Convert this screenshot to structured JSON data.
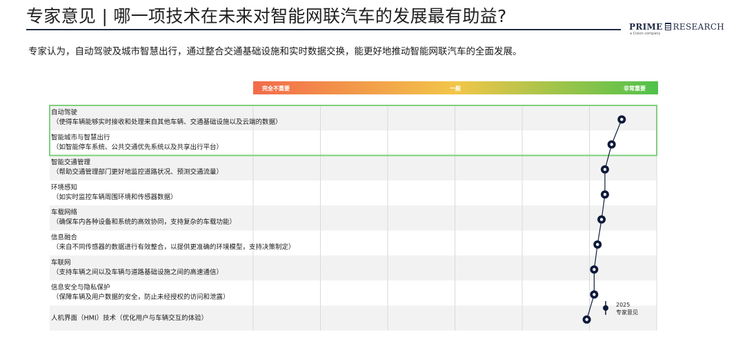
{
  "header": {
    "title": "专家意见 | 哪一项技术在未来对智能网联汽车的发展最有助益?",
    "subtitle": "专家认为，自动驾驶及城市智慧出行，通过整合交通基础设施和实时数据交换，能更好地推动智能网联汽车的全面发展。"
  },
  "logo": {
    "prime": "PRIME",
    "research": "RESEARCH",
    "sub": "a Cision company"
  },
  "colors": {
    "scale_start": "#f26b4a",
    "scale_mid": "#f2c64a",
    "scale_end": "#4fc24a",
    "highlight_border": "#7ed07e",
    "marker": "#0e1a3a",
    "row_shade": "#f2f2f2"
  },
  "chart_data": {
    "type": "scatter",
    "scale_labels": {
      "low": "完全不重要",
      "mid": "一般",
      "high": "非常重要"
    },
    "xlim": [
      0,
      6
    ],
    "grid": true,
    "highlight_rows": [
      0,
      1
    ],
    "legend": {
      "line1": "2025",
      "line2": "专家意见"
    },
    "items": [
      {
        "name": "自动驾驶",
        "desc": "（使得车辆能够实时接收和处理来自其他车辆、交通基础设施以及云端的数据）",
        "value": 5.48
      },
      {
        "name": "智能城市与智慧出行",
        "desc": "（如智能停车系统、公共交通优先系统以及共享出行平台）",
        "value": 5.33
      },
      {
        "name": "智能交通管理",
        "desc": "（帮助交通管理部门更好地监控道路状况、预测交通流量）",
        "value": 5.23
      },
      {
        "name": "环境感知",
        "desc": "（如实时监控车辆周围环境和传感器数据）",
        "value": 5.23
      },
      {
        "name": "车载网络",
        "desc": "（确保车内各种设备和系统的高效协同，支持复杂的车载功能）",
        "value": 5.18
      },
      {
        "name": "信息融合",
        "desc": "（来自不同传感器的数据进行有效整合，以提供更准确的环境模型，支持决策制定）",
        "value": 5.12
      },
      {
        "name": "车联网",
        "desc": "（支持车辆之间以及车辆与道路基础设施之间的高速通信）",
        "value": 5.07
      },
      {
        "name": "信息安全与隐私保护",
        "desc": "（保障车辆及用户数据的安全，防止未经授权的访问和泄露）",
        "value": 5.07
      },
      {
        "name": "人机界面（HMI）技术（优化用户与车辆交互的体验）",
        "desc": "",
        "value": 4.96
      }
    ]
  }
}
